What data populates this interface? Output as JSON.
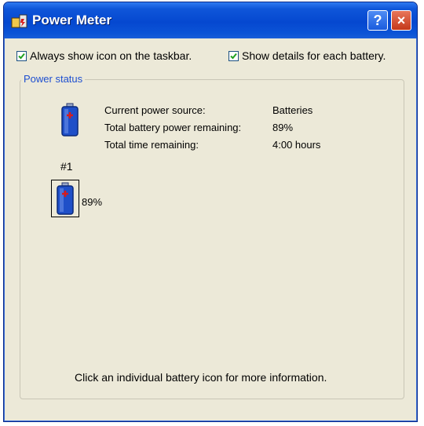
{
  "window": {
    "title": "Power Meter",
    "help_label": "?",
    "close_label": "×"
  },
  "options": {
    "always_show_icon": {
      "label": "Always show icon on the taskbar.",
      "checked": true
    },
    "show_details": {
      "label": "Show details for each battery.",
      "checked": true
    }
  },
  "power_status": {
    "group_label": "Power status",
    "rows": [
      {
        "label": "Current power source:",
        "value": "Batteries"
      },
      {
        "label": "Total battery power remaining:",
        "value": "89%"
      },
      {
        "label": "Total time remaining:",
        "value": "4:00 hours"
      }
    ],
    "batteries": [
      {
        "number": "#1",
        "percent": "89%",
        "icon": "battery-icon"
      }
    ]
  },
  "hint": "Click an individual battery icon for more information.",
  "colors": {
    "titlebar": "#0548d0",
    "dialog_bg": "#ece9d8",
    "group_label": "#1e4fd0",
    "battery_body": "#1f4fc8",
    "battery_plus": "#d81c1c"
  }
}
